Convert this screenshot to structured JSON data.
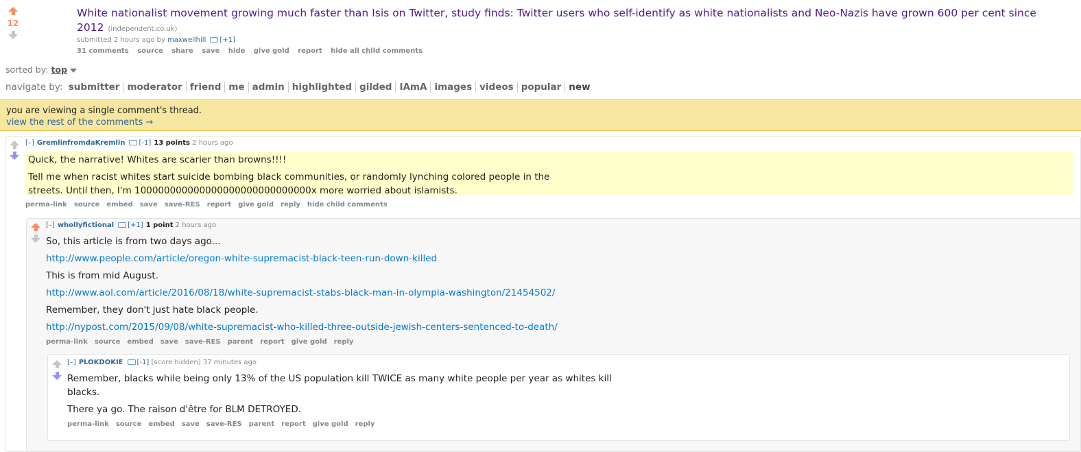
{
  "post": {
    "score": "12",
    "title": "White nationalist movement growing much faster than Isis on Twitter, study finds: Twitter users who self-identify as white nationalists and Neo-Nazis have grown 600 per cent since 2012",
    "domain": "(independent.co.uk)",
    "tagline_prefix": "submitted 2 hours ago by",
    "author": "maxwellhill",
    "author_karma": "[+1]",
    "buttons": [
      "31 comments",
      "source",
      "share",
      "save",
      "hide",
      "give gold",
      "report",
      "hide all child comments"
    ]
  },
  "sort": {
    "label": "sorted by:",
    "value": "top"
  },
  "navigate": {
    "label": "navigate by:",
    "items": [
      "submitter",
      "moderator",
      "friend",
      "me",
      "admin",
      "highlighted",
      "gilded",
      "IAmA",
      "images",
      "videos",
      "popular",
      "new"
    ]
  },
  "notice": {
    "text": "you are viewing a single comment's thread.",
    "link": "view the rest of the comments →"
  },
  "comments": [
    {
      "expand": "[–]",
      "author": "GremlinfromdaKremlin",
      "karma": "[-1]",
      "points": "13 points",
      "time": "2 hours ago",
      "paragraphs": [
        "Quick, the narrative! Whites are scarier than browns!!!!",
        "Tell me when racist whites start suicide bombing black communities, or randomly lynching colored people in the streets. Until then, I'm 100000000000000000000000000000x more worried about islamists."
      ],
      "buttons": [
        "perma-link",
        "source",
        "embed",
        "save",
        "save-RES",
        "report",
        "give gold",
        "reply",
        "hide child comments"
      ]
    },
    {
      "expand": "[–]",
      "author": "whollyfictional",
      "karma": "[+1]",
      "points": "1 point",
      "time": "2 hours ago",
      "paragraphs": [
        "So, this article is from two days ago...",
        "http://www.people.com/article/oregon-white-supremacist-black-teen-run-down-killed",
        "This is from mid August.",
        "http://www.aol.com/article/2016/08/18/white-supremacist-stabs-black-man-in-olympia-washington/21454502/",
        "Remember, they don't just hate black people.",
        "http://nypost.com/2015/09/08/white-supremacist-who-killed-three-outside-jewish-centers-sentenced-to-death/"
      ],
      "buttons": [
        "perma-link",
        "source",
        "embed",
        "save",
        "save-RES",
        "parent",
        "report",
        "give gold",
        "reply"
      ]
    },
    {
      "expand": "[–]",
      "author": "PLOKDOKIE",
      "karma": "[-1]",
      "points": "[score hidden]",
      "time": "37 minutes ago",
      "paragraphs": [
        "Remember, blacks while being only 13% of the US population kill TWICE as many white people per year as whites kill blacks.",
        "There ya go. The raison d'être for BLM DETROYED."
      ],
      "buttons": [
        "perma-link",
        "source",
        "embed",
        "save",
        "save-RES",
        "parent",
        "report",
        "give gold",
        "reply"
      ]
    }
  ]
}
